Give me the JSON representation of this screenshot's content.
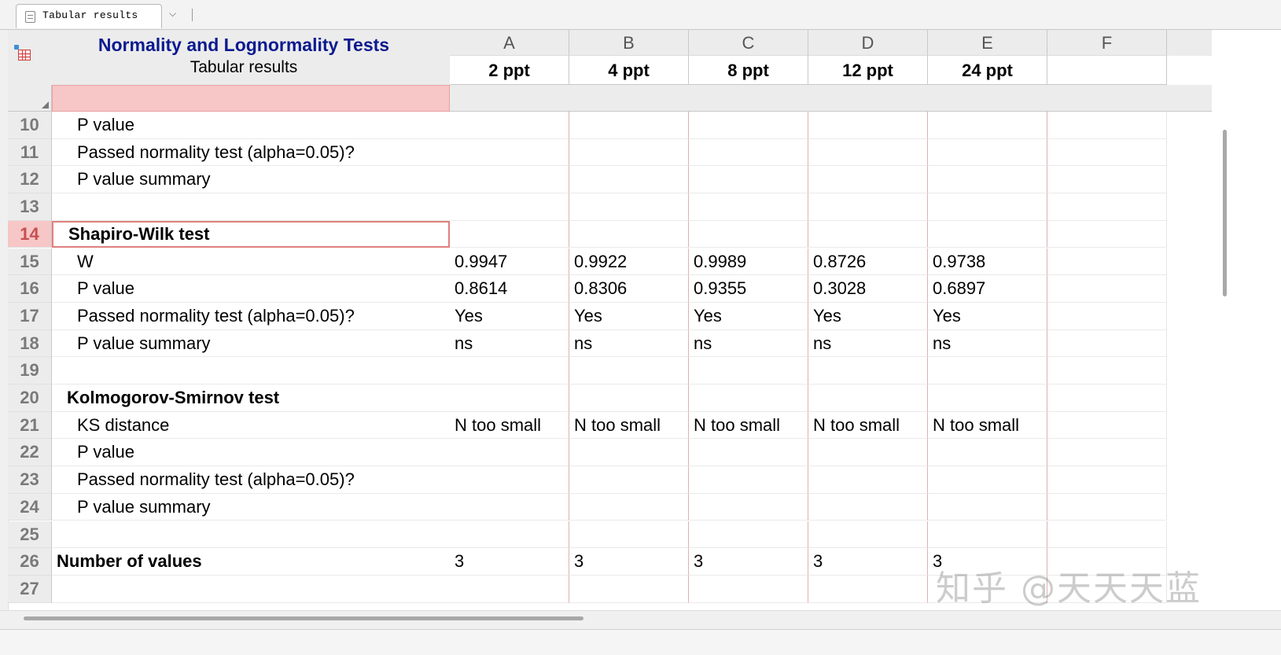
{
  "tab": {
    "label": "Tabular results",
    "dropdown_glyph": "⌵"
  },
  "sheet": {
    "title": "Normality and Lognormality Tests",
    "subtitle": "Tabular results"
  },
  "columns": [
    {
      "letter": "A",
      "title": "2 ppt"
    },
    {
      "letter": "B",
      "title": "4 ppt"
    },
    {
      "letter": "C",
      "title": "8 ppt"
    },
    {
      "letter": "D",
      "title": "12 ppt"
    },
    {
      "letter": "E",
      "title": "24 ppt"
    },
    {
      "letter": "F",
      "title": ""
    }
  ],
  "rows": [
    {
      "num": "10",
      "label": "P value",
      "style": "item",
      "values": [
        "",
        "",
        "",
        "",
        "",
        ""
      ]
    },
    {
      "num": "11",
      "label": "Passed normality test (alpha=0.05)?",
      "style": "item",
      "values": [
        "",
        "",
        "",
        "",
        "",
        ""
      ]
    },
    {
      "num": "12",
      "label": "P value summary",
      "style": "item",
      "values": [
        "",
        "",
        "",
        "",
        "",
        ""
      ]
    },
    {
      "num": "13",
      "label": "",
      "style": "item",
      "values": [
        "",
        "",
        "",
        "",
        "",
        ""
      ]
    },
    {
      "num": "14",
      "label": "Shapiro-Wilk test",
      "style": "section",
      "selected": true,
      "values": [
        "",
        "",
        "",
        "",
        "",
        ""
      ]
    },
    {
      "num": "15",
      "label": "W",
      "style": "item",
      "values": [
        "0.9947",
        "0.9922",
        "0.9989",
        "0.8726",
        "0.9738",
        ""
      ]
    },
    {
      "num": "16",
      "label": "P value",
      "style": "item",
      "values": [
        "0.8614",
        "0.8306",
        "0.9355",
        "0.3028",
        "0.6897",
        ""
      ]
    },
    {
      "num": "17",
      "label": "Passed normality test (alpha=0.05)?",
      "style": "item",
      "values": [
        "Yes",
        "Yes",
        "Yes",
        "Yes",
        "Yes",
        ""
      ]
    },
    {
      "num": "18",
      "label": "P value summary",
      "style": "item",
      "values": [
        "ns",
        "ns",
        "ns",
        "ns",
        "ns",
        ""
      ]
    },
    {
      "num": "19",
      "label": "",
      "style": "item",
      "values": [
        "",
        "",
        "",
        "",
        "",
        ""
      ]
    },
    {
      "num": "20",
      "label": "Kolmogorov-Smirnov test",
      "style": "section",
      "values": [
        "",
        "",
        "",
        "",
        "",
        ""
      ]
    },
    {
      "num": "21",
      "label": "KS distance",
      "style": "item",
      "values": [
        "N too small",
        "N too small",
        "N too small",
        "N too small",
        "N too small",
        ""
      ]
    },
    {
      "num": "22",
      "label": "P value",
      "style": "item",
      "values": [
        "",
        "",
        "",
        "",
        "",
        ""
      ]
    },
    {
      "num": "23",
      "label": "Passed normality test (alpha=0.05)?",
      "style": "item",
      "values": [
        "",
        "",
        "",
        "",
        "",
        ""
      ]
    },
    {
      "num": "24",
      "label": "P value summary",
      "style": "item",
      "values": [
        "",
        "",
        "",
        "",
        "",
        ""
      ]
    },
    {
      "num": "25",
      "label": "",
      "style": "item",
      "values": [
        "",
        "",
        "",
        "",
        "",
        ""
      ]
    },
    {
      "num": "26",
      "label": "Number of values",
      "style": "bold-top",
      "values": [
        "3",
        "3",
        "3",
        "3",
        "3",
        ""
      ]
    },
    {
      "num": "27",
      "label": "",
      "style": "item",
      "values": [
        "",
        "",
        "",
        "",
        "",
        ""
      ]
    }
  ],
  "watermark": "知乎 @天天天蓝"
}
